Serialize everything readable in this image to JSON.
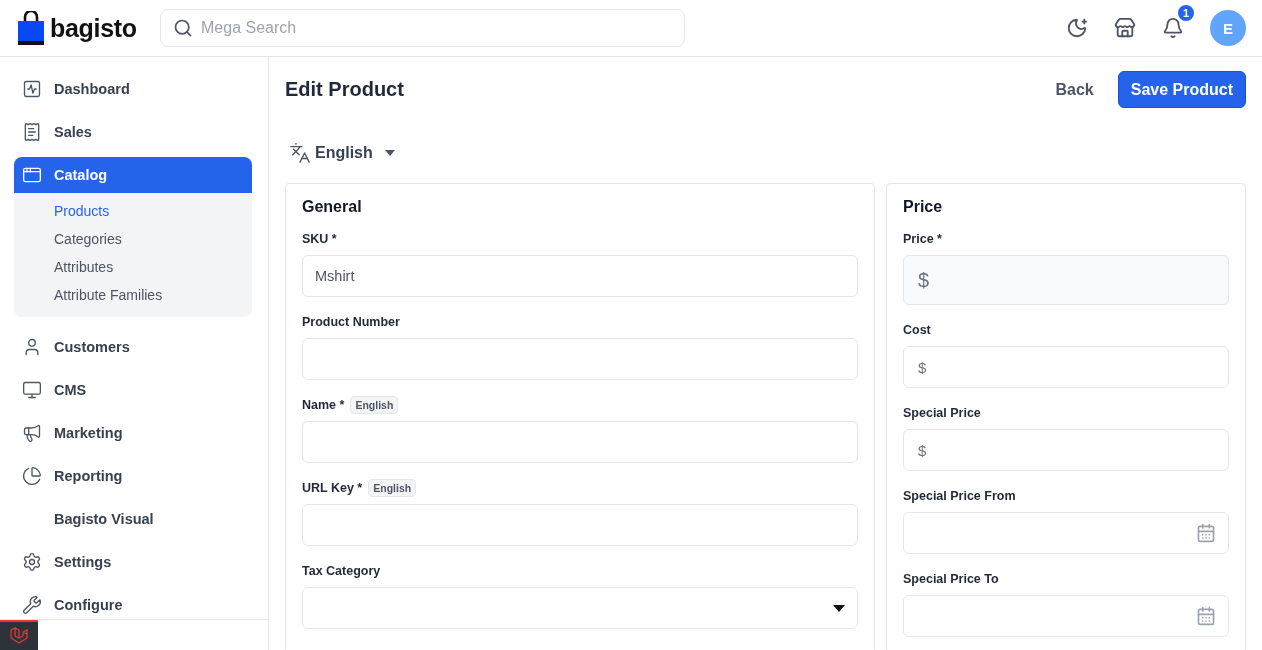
{
  "header": {
    "logo": "bagisto",
    "search": {
      "placeholder": "Mega Search"
    },
    "notifications": "1",
    "avatar": "E"
  },
  "sidebar": {
    "items": [
      {
        "label": "Dashboard",
        "selected": false
      },
      {
        "label": "Sales",
        "selected": false
      },
      {
        "label": "Catalog",
        "selected": true,
        "expanded": true,
        "children": [
          {
            "label": "Products",
            "selected": true
          },
          {
            "label": "Categories",
            "selected": false
          },
          {
            "label": "Attributes",
            "selected": false
          },
          {
            "label": "Attribute Families",
            "selected": false
          }
        ]
      },
      {
        "label": "Customers",
        "selected": false
      },
      {
        "label": "CMS",
        "selected": false
      },
      {
        "label": "Marketing",
        "selected": false
      },
      {
        "label": "Reporting",
        "selected": false
      },
      {
        "label": "Bagisto Visual",
        "selected": false
      },
      {
        "label": "Settings",
        "selected": false
      },
      {
        "label": "Configure",
        "selected": false
      }
    ]
  },
  "page": {
    "title": "Edit Product",
    "back": "Back",
    "save": "Save Product",
    "locale": "English"
  },
  "cards": [
    {
      "title": "General",
      "fields": [
        {
          "label": "SKU *",
          "kind": "text",
          "value": "Mshirt"
        },
        {
          "label": "Product Number",
          "kind": "text"
        },
        {
          "label": "Name *",
          "badge": "English",
          "kind": "text"
        },
        {
          "label": "URL Key *",
          "badge": "English",
          "kind": "text"
        },
        {
          "label": "Tax Category",
          "kind": "select"
        }
      ]
    },
    {
      "title": "Price",
      "fields": [
        {
          "label": "Price *",
          "kind": "currency",
          "prefix": "$",
          "disabled": true
        },
        {
          "label": "Cost",
          "kind": "currency",
          "prefix": "$",
          "disabled": false
        },
        {
          "label": "Special Price",
          "kind": "currency",
          "prefix": "$",
          "disabled": false
        },
        {
          "label": "Special Price From",
          "kind": "date"
        },
        {
          "label": "Special Price To",
          "kind": "date"
        }
      ]
    }
  ]
}
